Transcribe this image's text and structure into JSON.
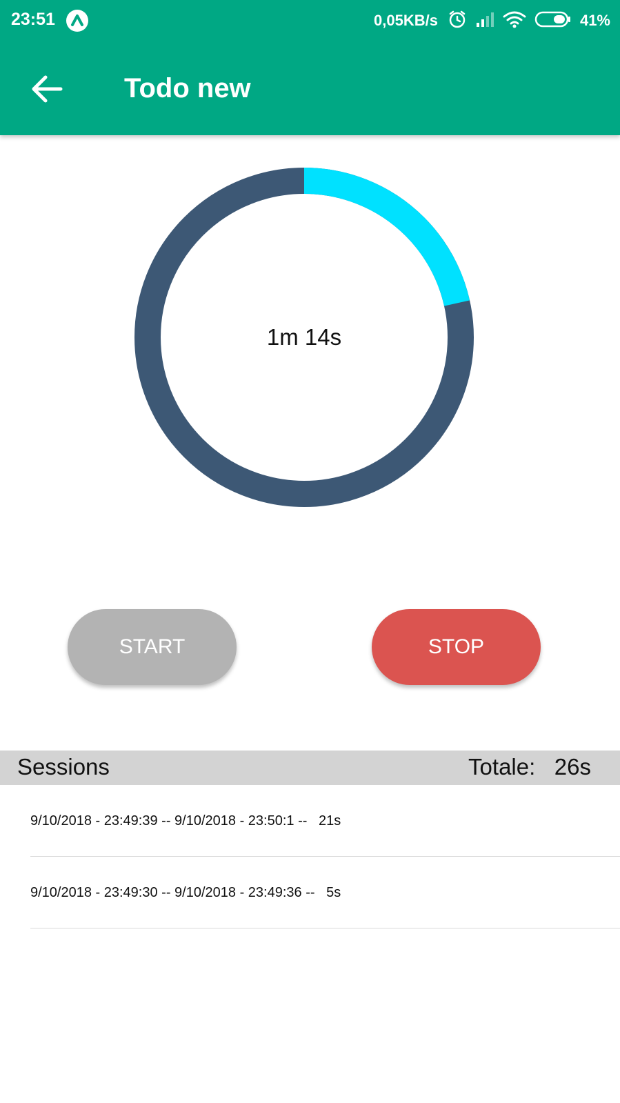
{
  "status_bar": {
    "time": "23:51",
    "speed": "0,05KB/s",
    "battery": "41%",
    "icons": [
      "app-notification-icon",
      "alarm-icon",
      "signal-icon",
      "wifi-icon",
      "battery-icon"
    ]
  },
  "app_bar": {
    "title": "Todo new",
    "back_icon": "arrow-left-icon",
    "background": "#00a884"
  },
  "timer": {
    "elapsed": "1m 14s",
    "progress_fraction": 0.215,
    "track_color": "#3d5875",
    "progress_color": "#00e1ff"
  },
  "buttons": {
    "start_label": "START",
    "stop_label": "STOP",
    "start_color": "#b3b3b3",
    "stop_color": "#db5450"
  },
  "sessions": {
    "label": "Sessions",
    "total": "Totale:   26s",
    "items": [
      {
        "text": "9/10/2018 - 23:49:39 -- 9/10/2018 - 23:50:1 --   21s"
      },
      {
        "text": "9/10/2018 - 23:49:30 -- 9/10/2018 - 23:49:36 --   5s"
      }
    ]
  }
}
